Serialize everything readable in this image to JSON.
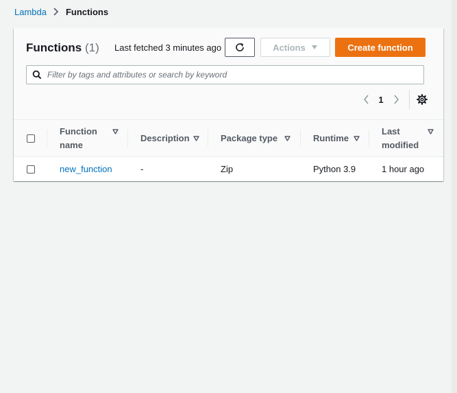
{
  "breadcrumb": {
    "parent": "Lambda",
    "current": "Functions"
  },
  "panel": {
    "title": "Functions",
    "count": "(1)",
    "last_fetched": "Last fetched 3 minutes ago",
    "actions_label": "Actions",
    "create_label": "Create function"
  },
  "search": {
    "placeholder": "Filter by tags and attributes or search by keyword",
    "value": ""
  },
  "pagination": {
    "current_page": "1"
  },
  "table": {
    "columns": [
      {
        "line1": "Function",
        "line2": "name"
      },
      {
        "line1": "Description",
        "line2": ""
      },
      {
        "line1": "Package type",
        "line2": ""
      },
      {
        "line1": "Runtime",
        "line2": ""
      },
      {
        "line1": "Last",
        "line2": "modified"
      }
    ],
    "rows": [
      {
        "function_name": "new_function",
        "description": "-",
        "package_type": "Zip",
        "runtime": "Python 3.9",
        "last_modified": "1 hour ago"
      }
    ]
  },
  "icons": {
    "breadcrumb_separator": "chevron-right-icon",
    "refresh": "refresh-icon",
    "actions_dropdown": "caret-down-icon",
    "search": "search-icon",
    "prev_page": "chevron-left-icon",
    "next_page": "chevron-right-icon",
    "preferences": "gear-icon",
    "sort": "sort-caret-icon"
  },
  "colors": {
    "primary_button": "#ec7211",
    "link": "#0073bb",
    "text": "#16191f",
    "secondary_text": "#545b64",
    "background": "#f2f3f3"
  }
}
